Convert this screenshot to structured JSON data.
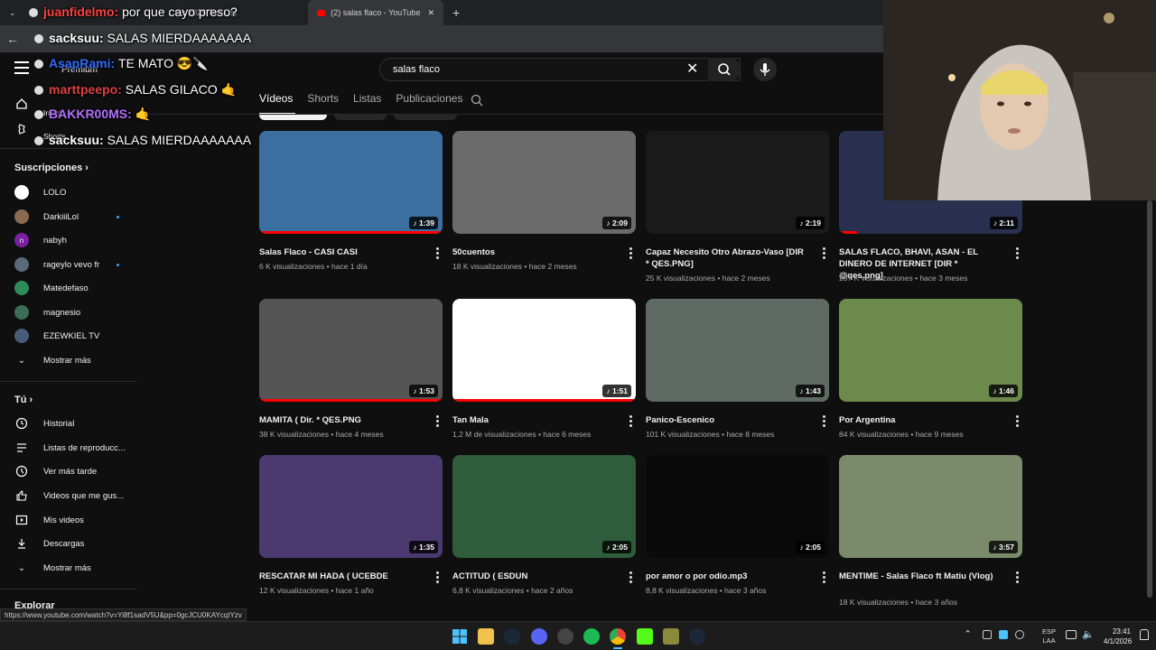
{
  "browser": {
    "tabs": [
      {
        "label": "Juan...",
        "partial": true
      },
      {
        "label": "... Chat ... Tier List 2025 Tier List",
        "partial": true
      },
      {
        "label": "(2) salas flaco - YouTube",
        "active": true
      }
    ],
    "tab_short": "(2) salas flaco - YouTube",
    "tab_left": "...tas 2025 Tier List"
  },
  "header": {
    "search_value": "salas flaco",
    "premium_label": "Premium"
  },
  "filters": {
    "items": [
      "Vídeos",
      "Shorts",
      "Listas",
      "Publicaciones"
    ],
    "active": "Vídeos"
  },
  "sidebar": {
    "nav": [
      {
        "label": "Inicio",
        "icon": "home-icon"
      },
      {
        "label": "Shorts",
        "icon": "shorts-icon"
      }
    ],
    "subs_heading": "Suscripciones",
    "subs": [
      {
        "label": "LOLO",
        "dot": false,
        "color": "#ffffff"
      },
      {
        "label": "DarkiiiLol",
        "dot": true,
        "color": "#8a6a50"
      },
      {
        "label": "nabyh",
        "dot": false,
        "color": "#7b1fa2"
      },
      {
        "label": "rageylo vevo fr",
        "dot": true,
        "color": "#5a6a7a"
      },
      {
        "label": "Matedefaso",
        "dot": false,
        "color": "#2e8b57"
      },
      {
        "label": "magnesio",
        "dot": false,
        "color": "#3b6e5a"
      },
      {
        "label": "EZEWKIEL TV",
        "dot": false,
        "color": "#4a5a7a"
      }
    ],
    "more_label": "Mostrar más",
    "you_heading": "Tú",
    "you": [
      {
        "label": "Historial",
        "icon": "history-icon"
      },
      {
        "label": "Listas de reproducc...",
        "icon": "playlists-icon"
      },
      {
        "label": "Ver más tarde",
        "icon": "watch-later-icon"
      },
      {
        "label": "Videos que me gus...",
        "icon": "like-icon"
      },
      {
        "label": "Mis videos",
        "icon": "my-videos-icon"
      },
      {
        "label": "Descargas",
        "icon": "download-icon"
      }
    ],
    "more_label2": "Mostrar más",
    "explore_heading": "Explorar"
  },
  "videos": [
    {
      "title": "Salas Flaco - CASI CASI",
      "meta": "6 K visualizaciones • hace 1 día",
      "duration": "1:39",
      "progress": 1.0,
      "bg": "#3a6fa0"
    },
    {
      "title": "50cuentos",
      "meta": "18 K visualizaciones • hace 2 meses",
      "duration": "2:09",
      "progress": 0,
      "bg": "#6b6b6b"
    },
    {
      "title": "Capaz Necesito Otro Abrazo-Vaso [DIR * QES.PNG]",
      "meta": "25 K visualizaciones • hace 2 meses",
      "duration": "2:19",
      "progress": 0,
      "bg": "#1a1a1a"
    },
    {
      "title": "SALAS FLACO, BHAVI, ASAN - EL DINERO DE INTERNET [DIR * @qes.png]",
      "meta": "207 K visualizaciones • hace 3 meses",
      "duration": "2:11",
      "progress": 0.1,
      "bg": "#2a3050"
    },
    {
      "title": "MAMITA ( Dir. * QES.PNG",
      "meta": "38 K visualizaciones • hace 4 meses",
      "duration": "1:53",
      "progress": 1.0,
      "bg": "#555555"
    },
    {
      "title": "Tan Mala",
      "meta": "1,2 M de visualizaciones • hace 6 meses",
      "duration": "1:51",
      "progress": 1.0,
      "bg": "#ffffff"
    },
    {
      "title": "Panico-Escenico",
      "meta": "101 K visualizaciones • hace 8 meses",
      "duration": "1:43",
      "progress": 0,
      "bg": "#5e6a63"
    },
    {
      "title": "Por Argentina",
      "meta": "84 K visualizaciones • hace 9 meses",
      "duration": "1:46",
      "progress": 0,
      "bg": "#6c8a4c"
    },
    {
      "title": "RESCATAR MI HADA ( UCEBDE",
      "meta": "12 K visualizaciones • hace 1 año",
      "duration": "1:35",
      "progress": 0,
      "bg": "#4a3a70"
    },
    {
      "title": "ACTITUD ( ESDUN",
      "meta": "6,8 K visualizaciones • hace 2 años",
      "duration": "2:05",
      "progress": 0,
      "bg": "#2f5c3a"
    },
    {
      "title": "por amor o por odio.mp3",
      "meta": "8,8 K visualizaciones • hace 3 años",
      "duration": "2:05",
      "progress": 0,
      "bg": "#0a0a0a"
    },
    {
      "title": "MENTIME - Salas Flaco ft Matiu (Vlog)",
      "meta": "18 K visualizaciones • hace 3 años",
      "duration": "3:57",
      "progress": 0,
      "bg": "#7a8a6a"
    }
  ],
  "chat": [
    {
      "user": "sacksuu:",
      "msg": "SALAS MIERDAAAAAAA",
      "color": "#ffffff"
    },
    {
      "user": "AsapRami:",
      "msg": "TE MATO 😎🔪",
      "color": "#2f6bff"
    },
    {
      "user": "marttpeepo:",
      "msg": "SALAS GILACO 🤙",
      "color": "#e04040"
    },
    {
      "user": "BAKKR00MS:",
      "msg": "🤙",
      "color": "#b070ff"
    },
    {
      "user": "sacksuu:",
      "msg": "SALAS MIERDAAAAAAA",
      "color": "#ffffff"
    },
    {
      "user": "juanfidelmo:",
      "msg": "por que cayo preso?",
      "color": "#ff4040"
    }
  ],
  "statusbar": {
    "url": "https://www.youtube.com/watch?v=Yi8f1sadV5U&pp=0gcJCU0KAYcqIYzv"
  },
  "taskbar": {
    "lang": "ESP",
    "lang2": "LAA",
    "time": "23:41",
    "date": "4/1/2026"
  }
}
